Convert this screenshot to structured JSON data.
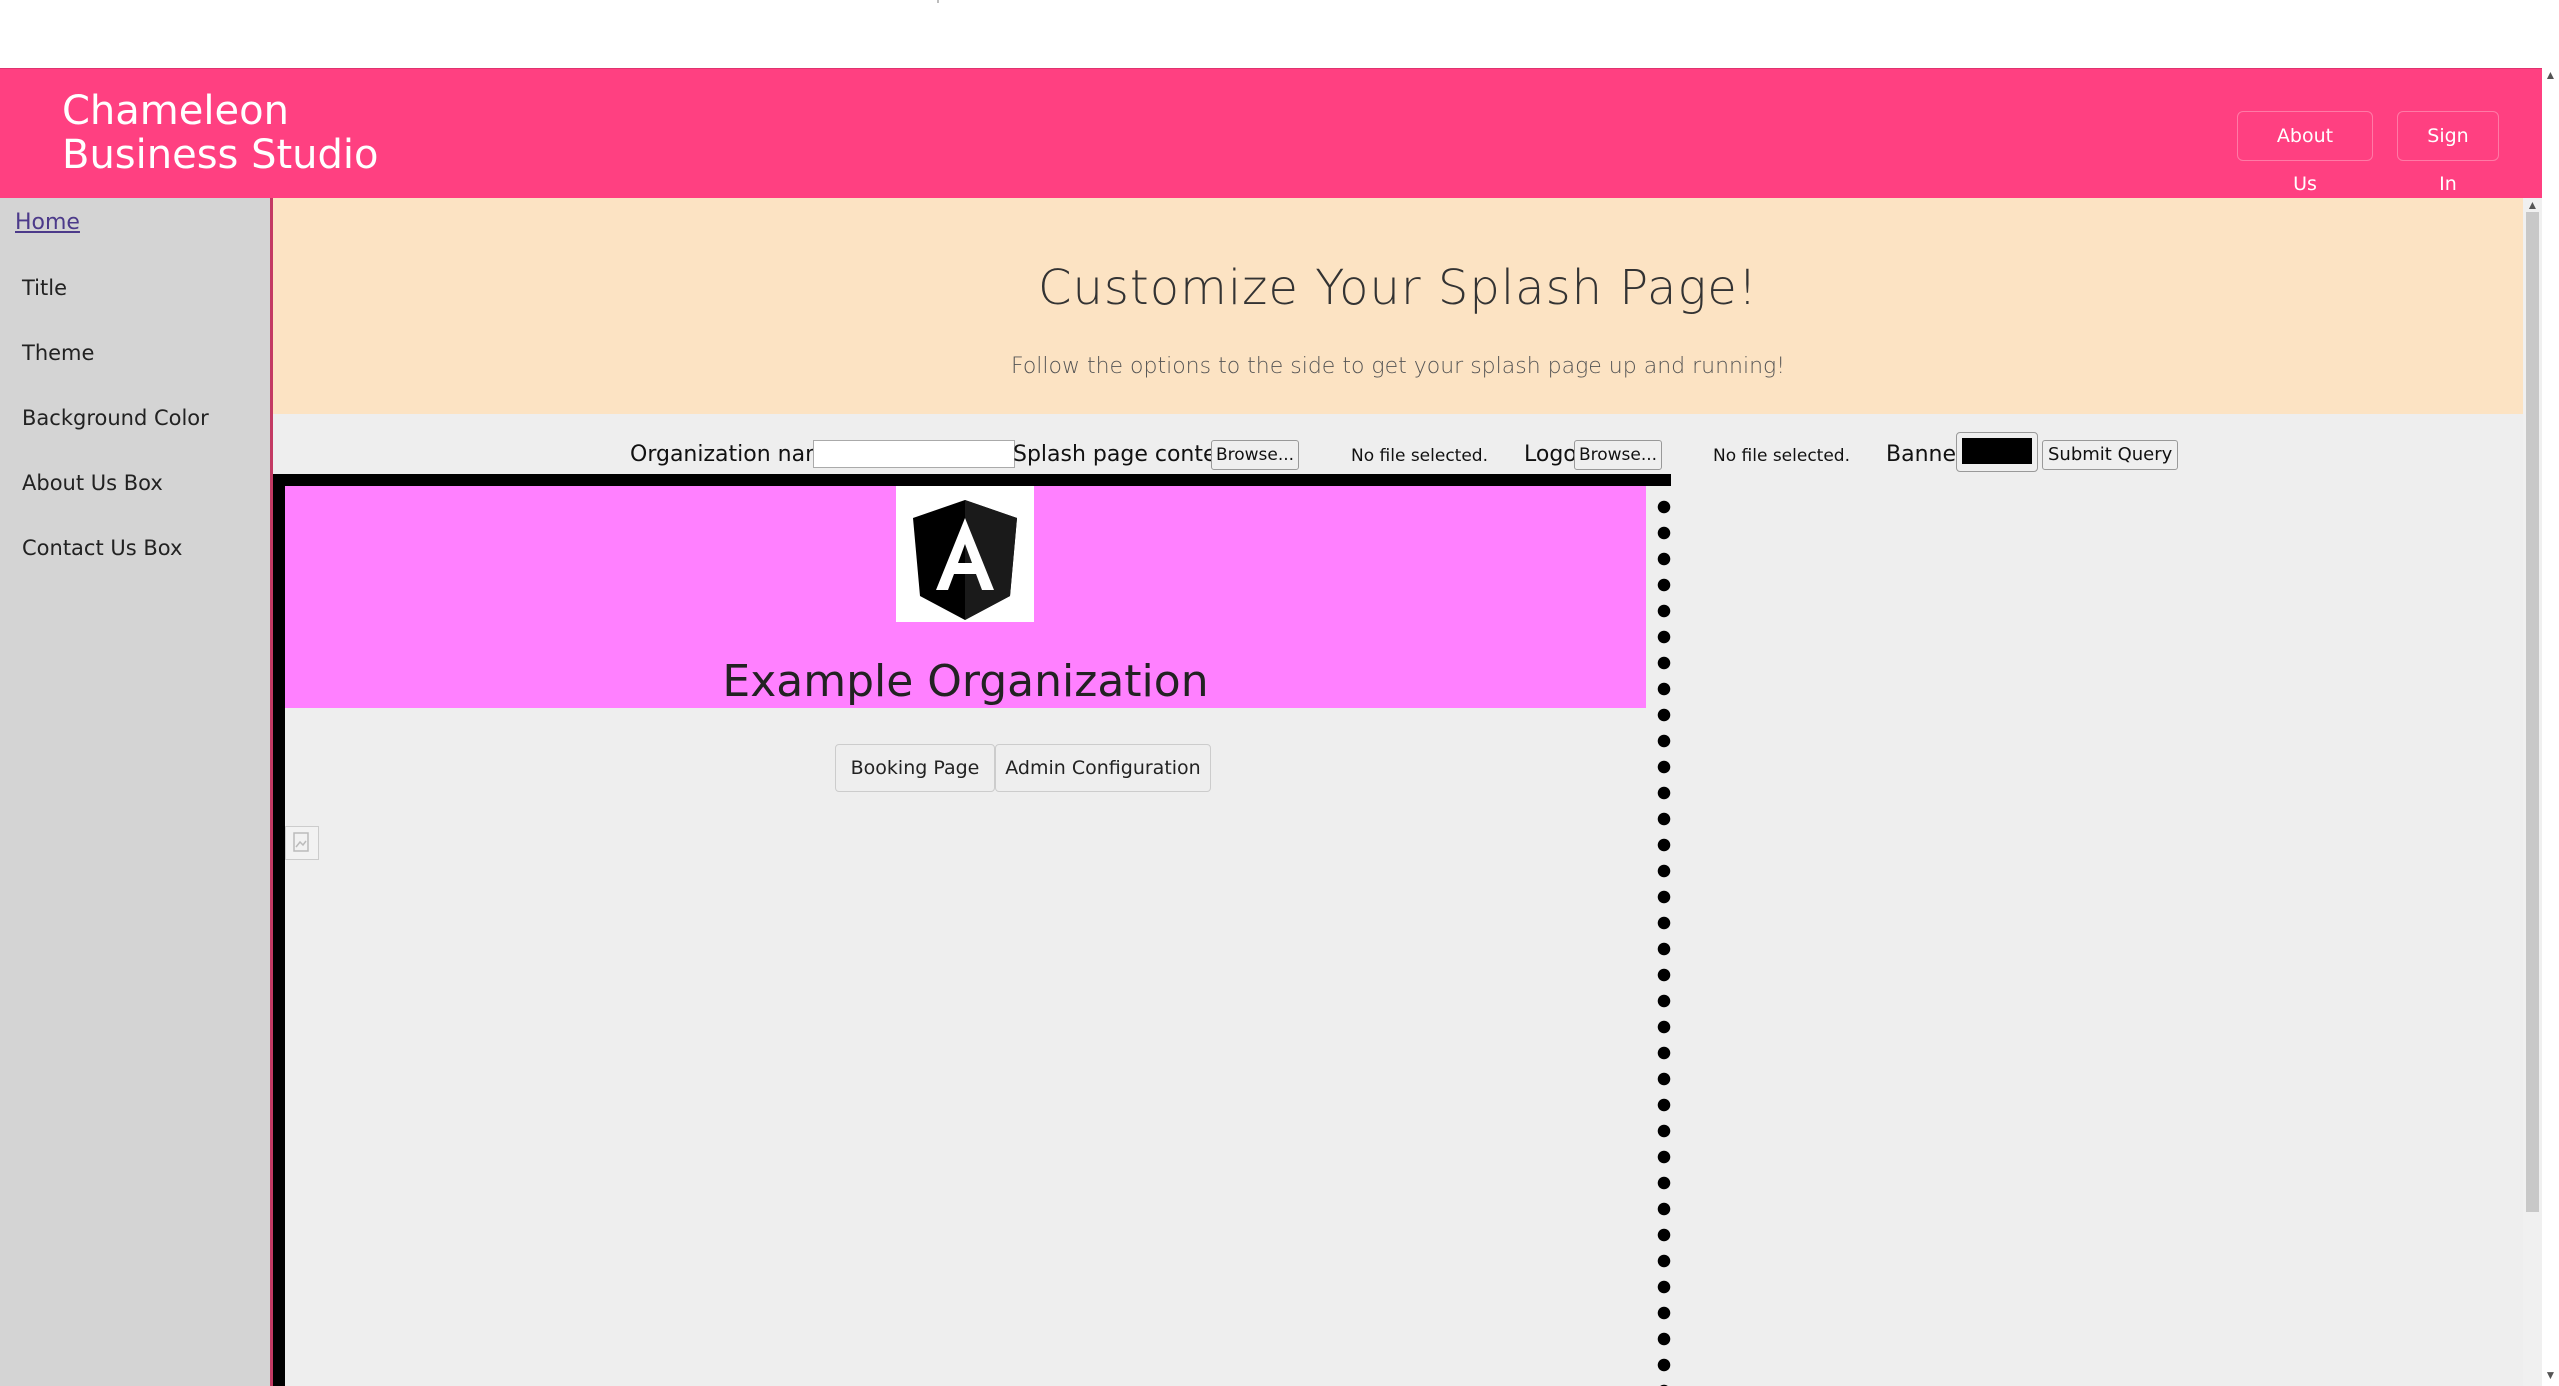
{
  "header": {
    "brand_line1": "Chameleon",
    "brand_line2": "Business Studio",
    "about_label": "About Us",
    "signin_label": "Sign In"
  },
  "sidebar": {
    "home_label": "Home",
    "items": [
      {
        "label": "Title"
      },
      {
        "label": "Theme"
      },
      {
        "label": "Background Color"
      },
      {
        "label": "About Us Box"
      },
      {
        "label": "Contact Us Box"
      }
    ]
  },
  "hero": {
    "title": "Customize Your Splash Page!",
    "subtitle": "Follow the options to the side to get your splash page up and running!"
  },
  "form": {
    "org_name_label": "Organization name",
    "org_name_value": "",
    "splash_content_label": "Splash page content",
    "browse_label": "Browse...",
    "no_file_label": "No file selected.",
    "logo_label": "Logo",
    "banner_label": "Banner",
    "banner_color": "#000000",
    "submit_label": "Submit Query"
  },
  "preview": {
    "banner_color": "#ff80ff",
    "logo_icon": "angular-logo-icon",
    "org_title": "Example Organization",
    "booking_label": "Booking Page",
    "admin_label": "Admin Configuration"
  },
  "colors": {
    "accent": "#ff4081",
    "hero_bg": "#fce3c3",
    "sidebar_bg": "#d4d4d4"
  }
}
